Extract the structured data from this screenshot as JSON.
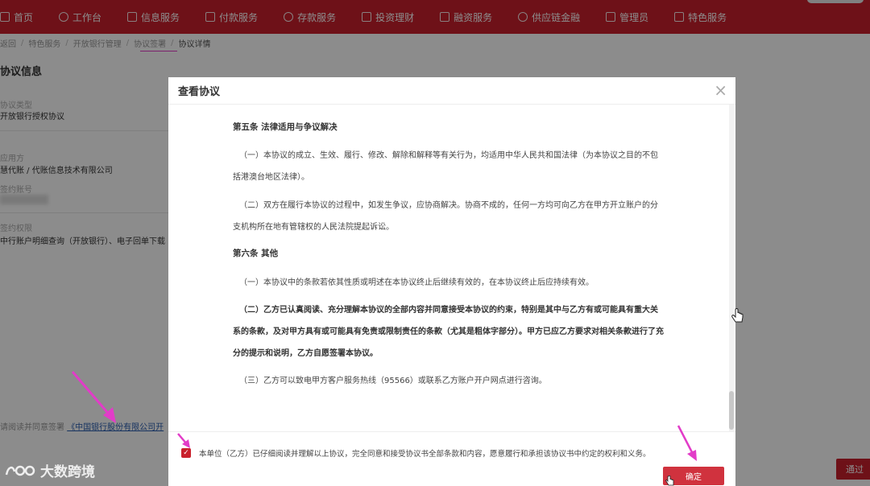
{
  "nav": {
    "items": [
      {
        "label": "首页",
        "icon": "home-icon"
      },
      {
        "label": "工作台",
        "icon": "monitor-icon"
      },
      {
        "label": "信息服务",
        "icon": "document-icon"
      },
      {
        "label": "付款服务",
        "icon": "card-icon"
      },
      {
        "label": "存款服务",
        "icon": "wallet-icon"
      },
      {
        "label": "投资理财",
        "icon": "coin-icon"
      },
      {
        "label": "融资服务",
        "icon": "briefcase-icon"
      },
      {
        "label": "供应链金融",
        "icon": "chain-icon"
      },
      {
        "label": "管理员",
        "icon": "gear-icon"
      },
      {
        "label": "特色服务",
        "icon": "grid-icon"
      }
    ]
  },
  "breadcrumb": [
    "返回",
    "特色服务",
    "开放银行管理",
    "协议签署",
    "协议详情"
  ],
  "page": {
    "title": "协议信息",
    "fields": [
      {
        "label": "协议类型",
        "value": "开放银行授权协议"
      },
      {
        "label": "应用方",
        "value": "慧代账 / 代账信息技术有限公司"
      },
      {
        "label": "签约账号",
        "value": ""
      },
      {
        "label": "签约权限",
        "value": "中行账户明细查询（开放银行）、电子回单下载"
      }
    ],
    "agree_prefix": "请阅读并同意签署",
    "agree_link": "《中国银行股份有限公司开",
    "pass_button": "通过"
  },
  "modal": {
    "title": "查看协议",
    "clause5_title": "第五条 法律适用与争议解决",
    "clause5_p1_l1": "（一）本协议的成立、生效、履行、修改、解除和解释等有关行为，均适用中华人民共和国法律（为本协议之目的不包",
    "clause5_p1_l2": "括港澳台地区法律）。",
    "clause5_p2_l1": "（二）双方在履行本协议的过程中，如发生争议，应协商解决。协商不成的，任何一方均可向乙方在甲方开立账户的分",
    "clause5_p2_l2": "支机构所在地有管辖权的人民法院提起诉讼。",
    "clause6_title": "第六条 其他",
    "clause6_p1": "（一）本协议中的条款若依其性质或明述在本协议终止后继续有效的，在本协议终止后应持续有效。",
    "clause6_p2_l1": "（二）乙方已认真阅读、充分理解本协议的全部内容并同意接受本协议的约束，特别是其中与乙方有或可能具有重大关",
    "clause6_p2_l2": "系的条款，及对甲方具有或可能具有免责或限制责任的条款（尤其是粗体字部分）。甲方已应乙方要求对相关条款进行了充",
    "clause6_p2_l3": "分的提示和说明，乙方自愿签署本协议。",
    "clause6_p3": "（三）乙方可以致电甲方客户服务热线（95566）或联系乙方账户开户网点进行咨询。",
    "agree_text": "本单位（乙方）已仔细阅读并理解以上协议，完全同意和接受协议书全部条款和内容，愿意履行和承担该协议书中约定的权利和义务。",
    "confirm_button": "确定",
    "close_glyph": "×",
    "checkbox_checked": true
  },
  "watermark": {
    "text": "大数跨境"
  },
  "colors": {
    "brand": "#c9202c",
    "annotation": "#e23cc8"
  }
}
